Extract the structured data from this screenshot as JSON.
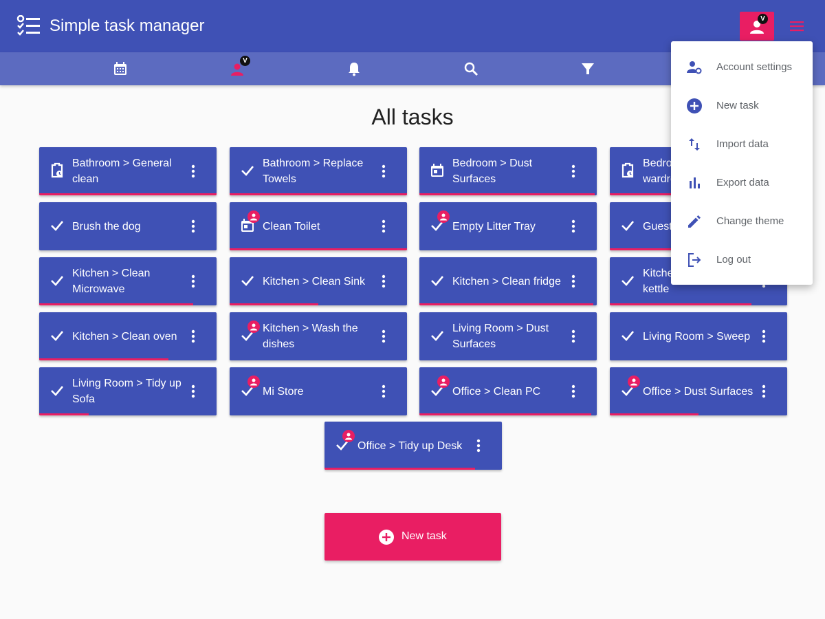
{
  "app": {
    "title": "Simple task manager",
    "logo_icon": "checklist-icon"
  },
  "header": {
    "profile_badge": "V",
    "profile_icon": "account-icon",
    "menu_icon": "menu-icon"
  },
  "toolbar": {
    "items": [
      {
        "icon": "calendar-icon"
      },
      {
        "icon": "person-filter-icon",
        "badge": "V"
      },
      {
        "icon": "bell-icon"
      },
      {
        "icon": "search-icon"
      },
      {
        "icon": "filter-icon"
      }
    ]
  },
  "page": {
    "title": "All tasks"
  },
  "tasks": [
    {
      "label": "Bathroom > General clean",
      "icon": "clipboard-clock-icon",
      "assigned": false,
      "progress": 1.0
    },
    {
      "label": "Bathroom > Replace Towels",
      "icon": "check-icon",
      "assigned": false,
      "progress": 1.0
    },
    {
      "label": "Bedroom > Dust Surfaces",
      "icon": "calendar-today-icon",
      "assigned": false,
      "progress": 0.99
    },
    {
      "label": "Bedroom > Tidy wardrobe",
      "icon": "clipboard-clock-icon",
      "assigned": false,
      "progress": 1.0
    },
    {
      "label": "Brush the dog",
      "icon": "check-icon",
      "assigned": false,
      "progress": 0.0
    },
    {
      "label": "Clean Toilet",
      "icon": "calendar-today-icon",
      "assigned": true,
      "progress": 1.0
    },
    {
      "label": "Empty Litter Tray",
      "icon": "check-icon",
      "assigned": true,
      "progress": 0.0
    },
    {
      "label": "Guest room > Tidy up",
      "icon": "check-icon",
      "assigned": false,
      "progress": 0.5
    },
    {
      "label": "Kitchen > Clean Microwave",
      "icon": "check-icon",
      "assigned": false,
      "progress": 0.87
    },
    {
      "label": "Kitchen > Clean Sink",
      "icon": "check-icon",
      "assigned": false,
      "progress": 0.5
    },
    {
      "label": "Kitchen > Clean fridge",
      "icon": "check-icon",
      "assigned": false,
      "progress": 0.98
    },
    {
      "label": "Kitchen > Descale kettle",
      "icon": "check-icon",
      "assigned": false,
      "progress": 0.8
    },
    {
      "label": "Kitchen > Clean oven",
      "icon": "check-icon",
      "assigned": false,
      "progress": 0.73
    },
    {
      "label": "Kitchen > Wash the dishes",
      "icon": "check-icon",
      "assigned": true,
      "progress": 0.0
    },
    {
      "label": "Living Room > Dust Surfaces",
      "icon": "check-icon",
      "assigned": false,
      "progress": 0.0
    },
    {
      "label": "Living Room > Sweep",
      "icon": "check-icon",
      "assigned": false,
      "progress": 0.0
    },
    {
      "label": "Living Room > Tidy up Sofa",
      "icon": "check-icon",
      "assigned": false,
      "progress": 0.28
    },
    {
      "label": "Mi Store",
      "icon": "check-icon",
      "assigned": true,
      "progress": 0.0
    },
    {
      "label": "Office > Clean PC",
      "icon": "check-icon",
      "assigned": true,
      "progress": 0.97
    },
    {
      "label": "Office > Dust Surfaces",
      "icon": "check-icon",
      "assigned": true,
      "progress": 0.5
    },
    {
      "label": "Office > Tidy up Desk",
      "icon": "check-icon",
      "assigned": true,
      "progress": 0.85
    }
  ],
  "new_task_button": {
    "label": "New task",
    "icon": "add-circle-icon"
  },
  "menu": {
    "items": [
      {
        "label": "Account settings",
        "icon": "account-settings-icon"
      },
      {
        "label": "New task",
        "icon": "add-circle-icon"
      },
      {
        "label": "Import data",
        "icon": "import-export-icon"
      },
      {
        "label": "Export data",
        "icon": "bar-chart-icon"
      },
      {
        "label": "Change theme",
        "icon": "pencil-icon"
      },
      {
        "label": "Log out",
        "icon": "logout-icon"
      }
    ]
  },
  "colors": {
    "primary": "#3f51b5",
    "primary_light": "#5c6bc0",
    "accent": "#e91e63",
    "background": "#fafafa"
  }
}
